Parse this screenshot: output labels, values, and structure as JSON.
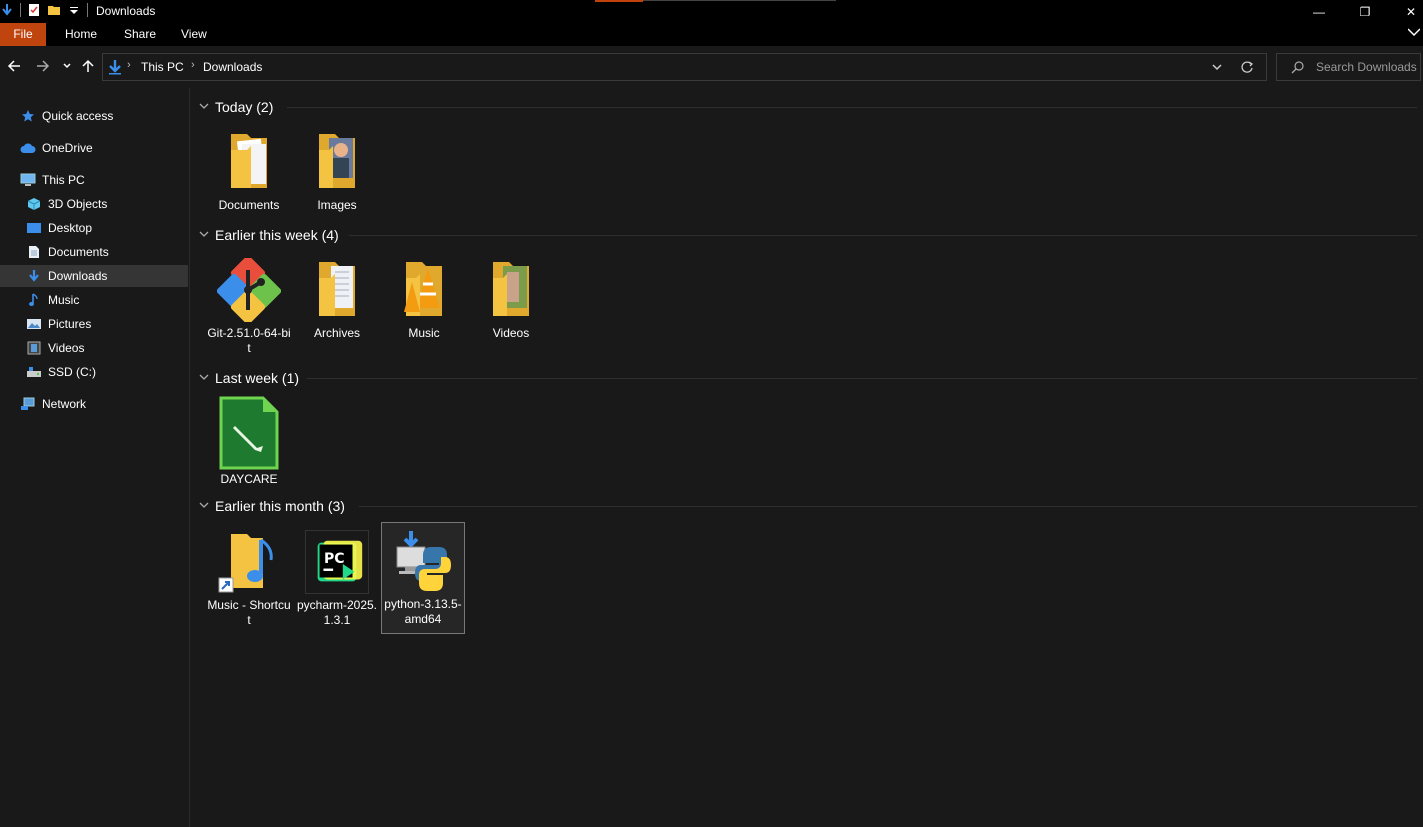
{
  "window": {
    "title": "Downloads",
    "minimize": "—",
    "restore": "❐",
    "close": "✕"
  },
  "ribbon": {
    "tabs": [
      "File",
      "Home",
      "Share",
      "View"
    ]
  },
  "address": {
    "crumbs": [
      "This PC",
      "Downloads"
    ],
    "search_placeholder": "Search Downloads"
  },
  "sidebar": {
    "items": [
      {
        "label": "Quick access",
        "icon": "star-icon"
      },
      {
        "label": "OneDrive",
        "icon": "cloud-icon"
      },
      {
        "label": "This PC",
        "icon": "computer-icon"
      },
      {
        "label": "3D Objects",
        "icon": "cube-icon"
      },
      {
        "label": "Desktop",
        "icon": "desktop-icon"
      },
      {
        "label": "Documents",
        "icon": "document-icon"
      },
      {
        "label": "Downloads",
        "icon": "download-icon"
      },
      {
        "label": "Music",
        "icon": "music-note-icon"
      },
      {
        "label": "Pictures",
        "icon": "picture-icon"
      },
      {
        "label": "Videos",
        "icon": "video-icon"
      },
      {
        "label": "SSD (C:)",
        "icon": "drive-icon"
      },
      {
        "label": "Network",
        "icon": "network-icon"
      }
    ]
  },
  "groups": [
    {
      "title": "Today (2)",
      "files": [
        "Documents",
        "Images"
      ]
    },
    {
      "title": "Earlier this week (4)",
      "files": [
        "Git-2.51.0-64-bit",
        "Archives",
        "Music",
        "Videos"
      ]
    },
    {
      "title": "Last week (1)",
      "files": [
        "DAYCARE"
      ]
    },
    {
      "title": "Earlier this month (3)",
      "files": [
        "Music - Shortcut",
        "pycharm-2025.1.3.1",
        "python-3.13.5-amd64"
      ]
    }
  ],
  "colors": {
    "accent": "#c0440e",
    "background": "#191919",
    "folder": "#f5c342"
  }
}
